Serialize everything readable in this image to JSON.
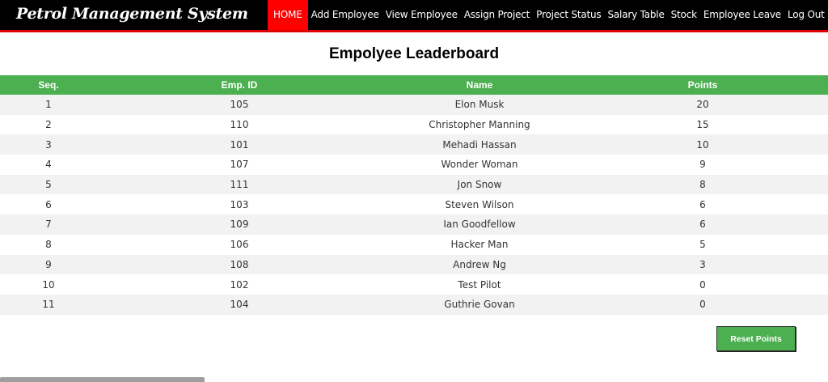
{
  "app": {
    "title": "Petrol Management System"
  },
  "nav": {
    "items": [
      {
        "label": "HOME",
        "active": true
      },
      {
        "label": "Add Employee"
      },
      {
        "label": "View Employee"
      },
      {
        "label": "Assign Project"
      },
      {
        "label": "Project Status"
      },
      {
        "label": "Salary Table"
      },
      {
        "label": "Stock"
      },
      {
        "label": "Employee Leave"
      },
      {
        "label": "Log Out"
      }
    ]
  },
  "page": {
    "title": "Empolyee Leaderboard"
  },
  "table": {
    "headers": [
      "Seq.",
      "Emp. ID",
      "Name",
      "Points"
    ],
    "rows": [
      [
        "1",
        "105",
        "Elon Musk",
        "20"
      ],
      [
        "2",
        "110",
        "Christopher Manning",
        "15"
      ],
      [
        "3",
        "101",
        "Mehadi Hassan",
        "10"
      ],
      [
        "4",
        "107",
        "Wonder Woman",
        "9"
      ],
      [
        "5",
        "111",
        "Jon Snow",
        "8"
      ],
      [
        "6",
        "103",
        "Steven Wilson",
        "6"
      ],
      [
        "7",
        "109",
        "Ian Goodfellow",
        "6"
      ],
      [
        "8",
        "106",
        "Hacker Man",
        "5"
      ],
      [
        "9",
        "108",
        "Andrew Ng",
        "3"
      ],
      [
        "10",
        "102",
        "Test Pilot",
        "0"
      ],
      [
        "11",
        "104",
        "Guthrie Govan",
        "0"
      ]
    ]
  },
  "actions": {
    "reset_label": "Reset Points"
  },
  "colors": {
    "nav_bg": "#000000",
    "accent_red": "#ff0000",
    "header_green": "#4caf50"
  }
}
